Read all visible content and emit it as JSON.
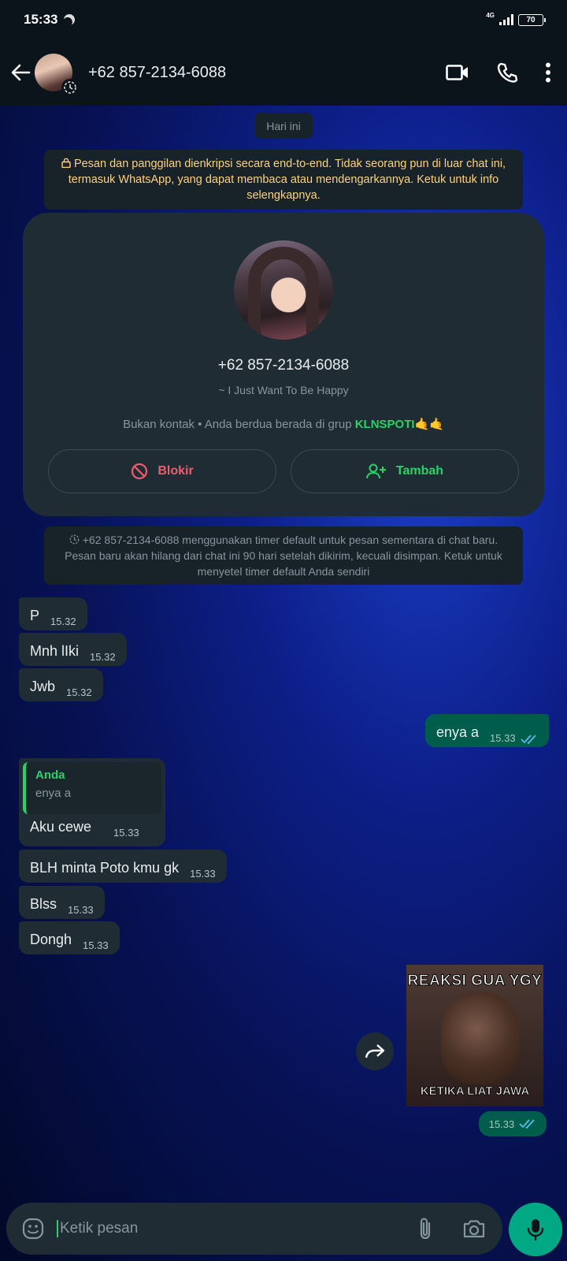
{
  "status_bar": {
    "time": "15:33",
    "network": "4G",
    "battery": "70"
  },
  "header": {
    "contact_name": "+62 857-2134-6088"
  },
  "chat": {
    "date_label": "Hari ini",
    "encryption_notice": "Pesan dan panggilan dienkripsi secara end-to-end. Tidak seorang pun di luar chat ini, termasuk WhatsApp, yang dapat membaca atau mendengarkannya. Ketuk untuk info selengkapnya.",
    "contact_card": {
      "name": "+62 857-2134-6088",
      "about": "~ I Just Want To Be Happy",
      "group_info_prefix": "Bukan kontak • Anda berdua berada di grup ",
      "group_name": "KLNSPOTI",
      "group_emoji": "🤙🤙",
      "block_label": "Blokir",
      "add_label": "Tambah"
    },
    "timer_notice": "+62 857-2134-6088 menggunakan timer default untuk pesan sementara di chat baru. Pesan baru akan hilang dari chat ini 90 hari setelah dikirim, kecuali disimpan. Ketuk untuk menyetel timer default Anda sendiri",
    "messages": [
      {
        "text": "P",
        "time": "15.32"
      },
      {
        "text": "Mnh lIki",
        "time": "15.32"
      },
      {
        "text": "Jwb",
        "time": "15.32"
      },
      {
        "text": "enya a",
        "time": "15.33"
      },
      {
        "reply_author": "Anda",
        "reply_text": "enya a",
        "text": "Aku cewe",
        "time": "15.33"
      },
      {
        "text": "BLH minta Poto kmu gk",
        "time": "15.33"
      },
      {
        "text": "Blss",
        "time": "15.33"
      },
      {
        "text": "Dongh",
        "time": "15.33"
      }
    ],
    "sticker": {
      "top_text": "REAKSI GUA YGY",
      "bottom_text": "KETIKA LIAT JAWA",
      "time": "15.33"
    }
  },
  "composer": {
    "placeholder": "Ketik pesan"
  },
  "colors": {
    "accent": "#25d366",
    "outgoing_bubble": "#005c4b",
    "incoming_bubble": "#1f2c34",
    "header_bg": "#0b141a"
  },
  "icons": [
    "moon-icon",
    "signal-icon",
    "battery-icon",
    "back-arrow-icon",
    "timer-icon",
    "video-call-icon",
    "phone-icon",
    "more-vert-icon",
    "lock-icon",
    "block-icon",
    "add-person-icon",
    "double-check-icon",
    "forward-icon",
    "emoji-icon",
    "attach-icon",
    "camera-icon",
    "mic-icon"
  ]
}
